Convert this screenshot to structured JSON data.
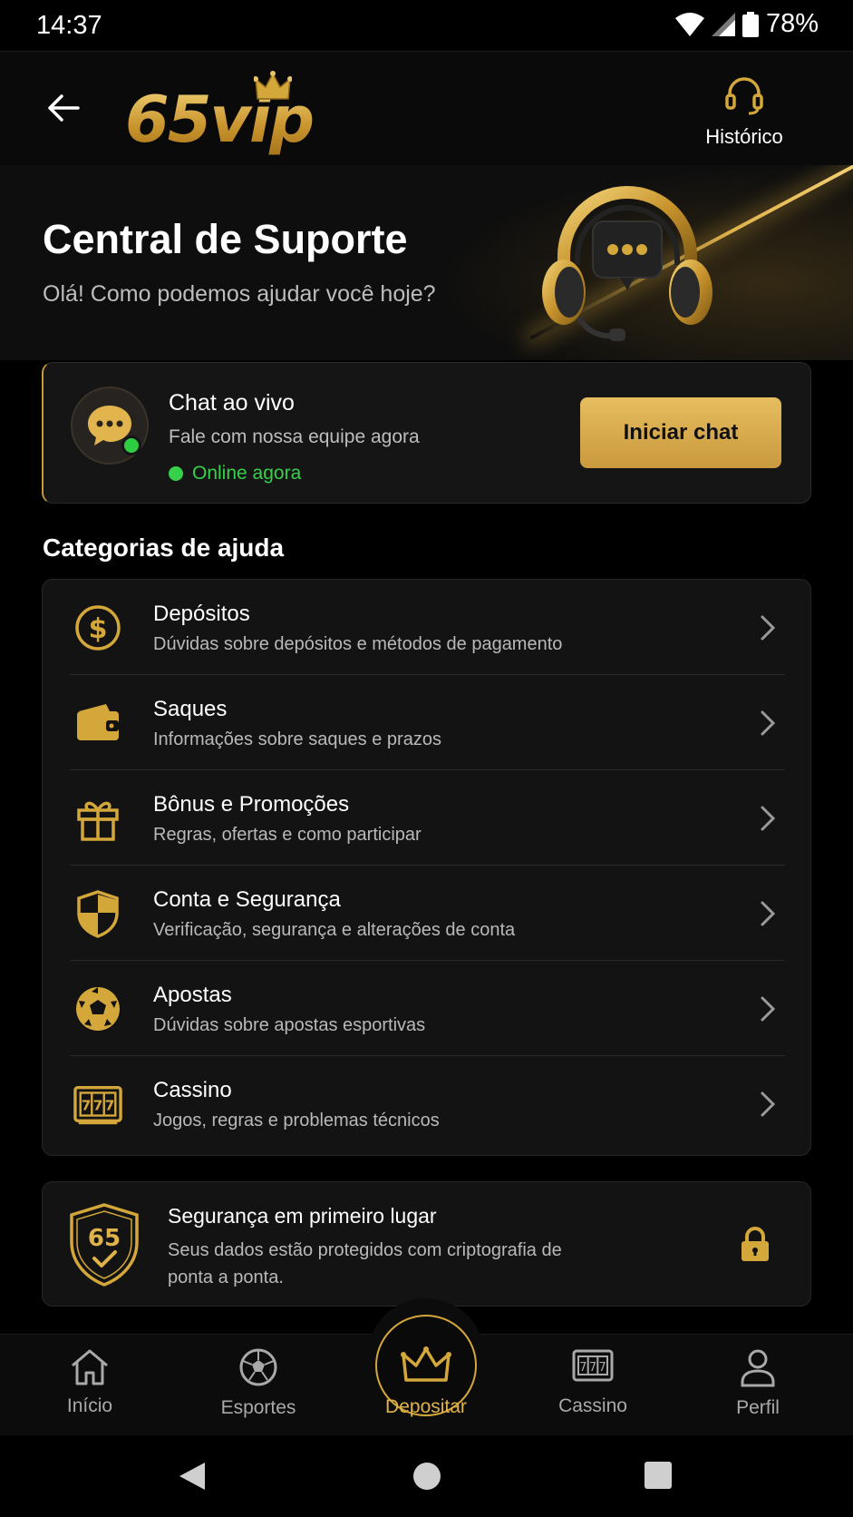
{
  "status_bar": {
    "time": "14:37",
    "battery": "78%"
  },
  "header": {
    "logo_text": "65vip",
    "history_label": "Histórico"
  },
  "hero": {
    "title": "Central de Suporte",
    "subtitle": "Olá! Como podemos ajudar você hoje?"
  },
  "chat": {
    "title": "Chat ao vivo",
    "subtitle": "Fale com nossa equipe agora",
    "status": "Online agora",
    "button": "Iniciar chat",
    "status_color": "#37d04a"
  },
  "categories": {
    "heading": "Categorias de ajuda",
    "items": [
      {
        "title": "Depósitos",
        "desc": "Dúvidas sobre depósitos e métodos de pagamento",
        "icon": "dollar-coin-icon"
      },
      {
        "title": "Saques",
        "desc": "Informações sobre saques e prazos",
        "icon": "wallet-icon"
      },
      {
        "title": "Bônus e Promoções",
        "desc": "Regras, ofertas e como participar",
        "icon": "gift-icon"
      },
      {
        "title": "Conta e Segurança",
        "desc": "Verificação, segurança e alterações de conta",
        "icon": "shield-icon"
      },
      {
        "title": "Apostas",
        "desc": "Dúvidas sobre apostas esportivas",
        "icon": "soccer-ball-icon"
      },
      {
        "title": "Cassino",
        "desc": "Jogos, regras e problemas técnicos",
        "icon": "slot-machine-icon"
      }
    ]
  },
  "security": {
    "title": "Segurança em primeiro lugar",
    "desc": "Seus dados estão protegidos com criptografia de ponta a ponta.",
    "badge": "65"
  },
  "nav": {
    "items": [
      {
        "label": "Início",
        "icon": "home-icon"
      },
      {
        "label": "Esportes",
        "icon": "soccer-ball-icon"
      },
      {
        "label": "Depositar",
        "icon": "crown-icon",
        "active": true
      },
      {
        "label": "Cassino",
        "icon": "slot-machine-icon"
      },
      {
        "label": "Perfil",
        "icon": "user-icon"
      }
    ]
  },
  "colors": {
    "accent": "#d4a73b",
    "background": "#0a0a0a",
    "card": "#131313"
  }
}
